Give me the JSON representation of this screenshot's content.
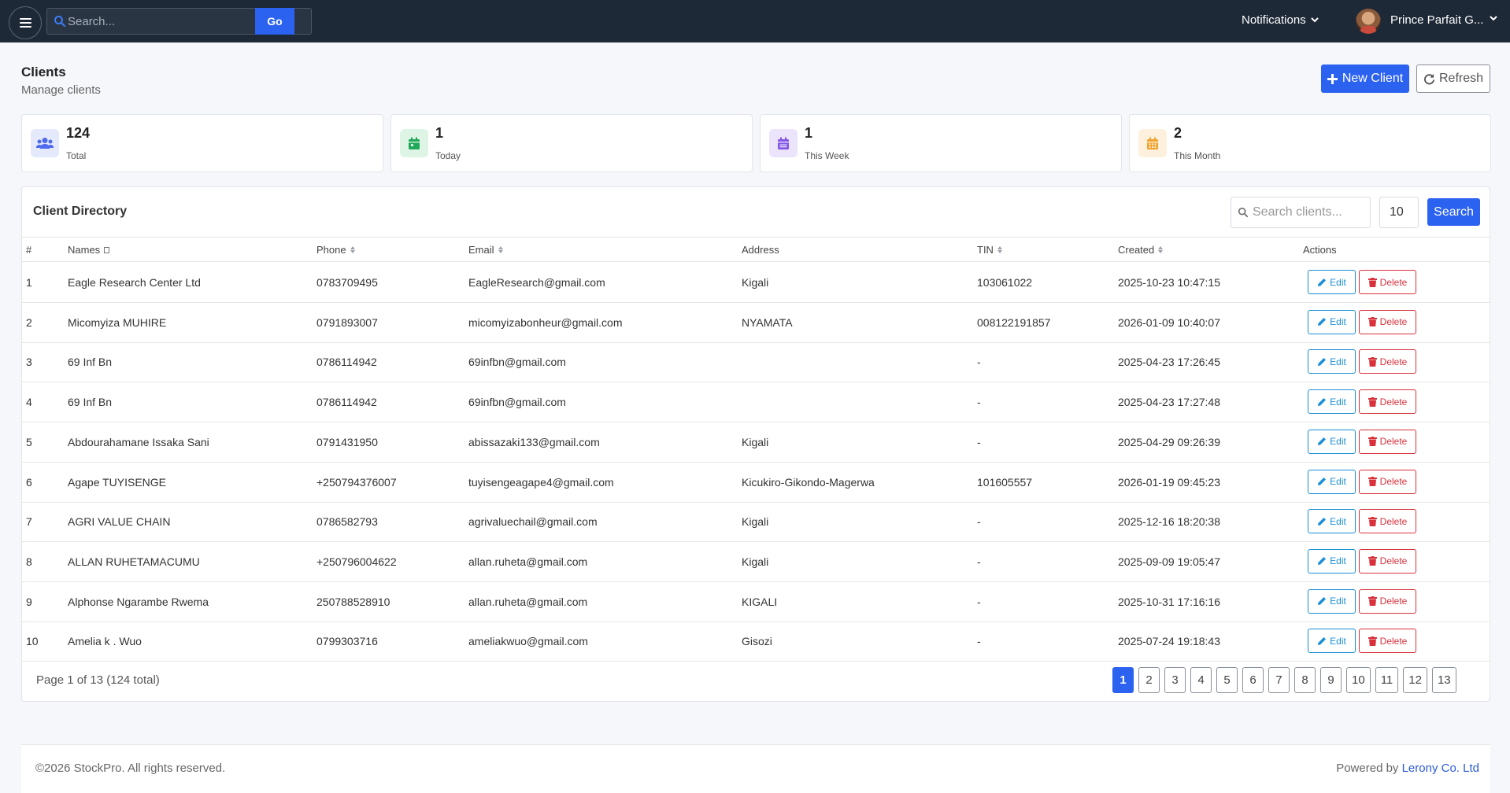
{
  "nav": {
    "search_placeholder": "Search...",
    "go_label": "Go",
    "notifications_label": "Notifications",
    "user_name": "Prince Parfait G..."
  },
  "header": {
    "title": "Clients",
    "subtitle": "Manage clients",
    "new_client_label": "New Client",
    "refresh_label": "Refresh"
  },
  "stats": [
    {
      "value": "124",
      "label": "Total",
      "color": "#4f6bed",
      "bg": "#e4e9fc",
      "icon": "users-icon"
    },
    {
      "value": "1",
      "label": "Today",
      "color": "#22a85a",
      "bg": "#def5e6",
      "icon": "calendar-day-icon"
    },
    {
      "value": "1",
      "label": "This Week",
      "color": "#8257e6",
      "bg": "#ece4fb",
      "icon": "calendar-week-icon"
    },
    {
      "value": "2",
      "label": "This Month",
      "color": "#f0a22e",
      "bg": "#fdf0dc",
      "icon": "calendar-month-icon"
    }
  ],
  "directory": {
    "title": "Client Directory",
    "search_placeholder": "Search clients...",
    "per_page": "10",
    "search_label": "Search",
    "columns": [
      "#",
      "Names",
      "Phone",
      "Email",
      "Address",
      "TIN",
      "Created",
      "Actions"
    ],
    "rows": [
      {
        "num": "1",
        "name": "Eagle Research Center Ltd",
        "phone": "0783709495",
        "email": "EagleResearch@gmail.com",
        "address": "Kigali",
        "tin": "103061022",
        "created": "2025-10-23 10:47:15"
      },
      {
        "num": "2",
        "name": "Micomyiza MUHIRE",
        "phone": "0791893007",
        "email": "micomyizabonheur@gmail.com",
        "address": "NYAMATA",
        "tin": "008122191857",
        "created": "2026-01-09 10:40:07"
      },
      {
        "num": "3",
        "name": "69 Inf Bn",
        "phone": "0786114942",
        "email": "69infbn@gmail.com",
        "address": "",
        "tin": "-",
        "created": "2025-04-23 17:26:45"
      },
      {
        "num": "4",
        "name": "69 Inf Bn",
        "phone": "0786114942",
        "email": "69infbn@gmail.com",
        "address": "",
        "tin": "-",
        "created": "2025-04-23 17:27:48"
      },
      {
        "num": "5",
        "name": "Abdourahamane Issaka Sani",
        "phone": "0791431950",
        "email": "abissazaki133@gmail.com",
        "address": "Kigali",
        "tin": "-",
        "created": "2025-04-29 09:26:39"
      },
      {
        "num": "6",
        "name": "Agape TUYISENGE",
        "phone": "+250794376007",
        "email": "tuyisengeagape4@gmail.com",
        "address": "Kicukiro-Gikondo-Magerwa",
        "tin": "101605557",
        "created": "2026-01-19 09:45:23"
      },
      {
        "num": "7",
        "name": "AGRI VALUE CHAIN",
        "phone": "0786582793",
        "email": "agrivaluechail@gmail.com",
        "address": "Kigali",
        "tin": "-",
        "created": "2025-12-16 18:20:38"
      },
      {
        "num": "8",
        "name": "ALLAN RUHETAMACUMU",
        "phone": "+250796004622",
        "email": "allan.ruheta@gmail.com",
        "address": "Kigali",
        "tin": "-",
        "created": "2025-09-09 19:05:47"
      },
      {
        "num": "9",
        "name": "Alphonse Ngarambe Rwema",
        "phone": "250788528910",
        "email": "allan.ruheta@gmail.com",
        "address": "KIGALI",
        "tin": "-",
        "created": "2025-10-31 17:16:16"
      },
      {
        "num": "10",
        "name": "Amelia k . Wuo",
        "phone": "0799303716",
        "email": "ameliakwuo@gmail.com",
        "address": "Gisozi",
        "tin": "-",
        "created": "2025-07-24 19:18:43"
      }
    ],
    "edit_label": "Edit",
    "delete_label": "Delete",
    "page_info": "Page 1 of 13 (124 total)",
    "pages": [
      "1",
      "2",
      "3",
      "4",
      "5",
      "6",
      "7",
      "8",
      "9",
      "10",
      "11",
      "12",
      "13"
    ],
    "active_page": "1"
  },
  "footer": {
    "copyright": "©2026 StockPro. All rights reserved.",
    "powered_prefix": "Powered by",
    "powered_link": "Lerony Co. Ltd"
  },
  "colors": {
    "navbar": "#1e2937",
    "primary": "#2c62f0",
    "edit": "#1a8fd8",
    "delete": "#d8313b"
  }
}
